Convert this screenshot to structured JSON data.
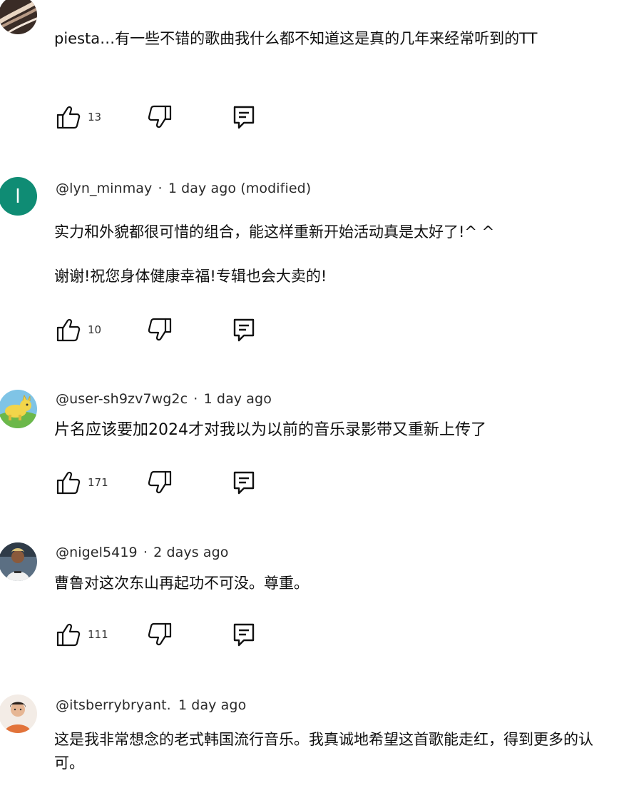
{
  "comments": [
    {
      "handle": "",
      "meta": "",
      "text": [
        "piesta…有一些不错的歌曲我什么都不知道这是真的几年来经常听到的TT"
      ],
      "likes": "13",
      "avatar": "swirl-photo-avatar"
    },
    {
      "handle": "@lyn_minmay",
      "meta": "1 day ago (modified)",
      "text": [
        "实力和外貌都很可惜的组合，能这样重新开始活动真是太好了!^ ^",
        "谢谢!祝您身体健康幸福!专辑也会大卖的!"
      ],
      "likes": "10",
      "avatar": "letter-avatar",
      "avatar_letter": "l",
      "avatar_color": "#0f8c74"
    },
    {
      "handle": "@user-sh9zv7wg2c",
      "meta": "1 day ago",
      "text": [
        "片名应该要加2024才对我以为以前的音乐录影带又重新上传了"
      ],
      "likes": "171",
      "avatar": "cartoon-animal-avatar"
    },
    {
      "handle": "@nigel5419",
      "meta": "2 days ago",
      "text": [
        "曹鲁对这次东山再起功不可没。尊重。"
      ],
      "likes": "111",
      "avatar": "player-photo-avatar"
    },
    {
      "handle": "@itsberrybryant.",
      "meta": "1 day ago",
      "text": [
        "这是我非常想念的老式韩国流行音乐。我真诚地希望这首歌能走红，得到更多的认可。"
      ],
      "likes": "",
      "avatar": "person-photo-avatar"
    }
  ],
  "icons": {
    "like": "thumbs-up-icon",
    "dislike": "thumbs-down-icon",
    "reply": "reply-comment-icon"
  }
}
